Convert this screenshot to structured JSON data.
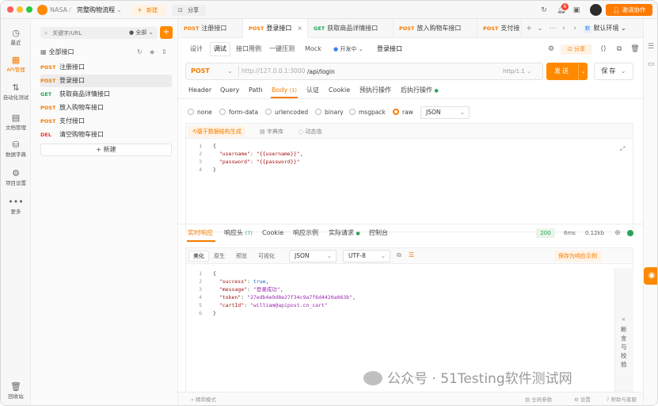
{
  "titlebar": {
    "team": "NASA",
    "project": "完整购物流程",
    "new_label": "新建",
    "share_label": "分享",
    "notif_count": "6",
    "invite_label": "邀请协作"
  },
  "leftnav": [
    {
      "label": "最近",
      "icon": "clock-icon",
      "glyph": "◷"
    },
    {
      "label": "API管理",
      "icon": "api-icon",
      "glyph": "▦"
    },
    {
      "label": "自动化测试",
      "icon": "flow-icon",
      "glyph": "⇅"
    },
    {
      "label": "文档管理",
      "icon": "doc-icon",
      "glyph": "▤"
    },
    {
      "label": "数据字典",
      "icon": "dict-icon",
      "glyph": "⛁"
    },
    {
      "label": "项目设置",
      "icon": "gear-icon",
      "glyph": "⚙"
    },
    {
      "label": "更多",
      "icon": "more-icon",
      "glyph": "•••"
    },
    {
      "label": "回收站",
      "icon": "trash-icon",
      "glyph": "🗑"
    }
  ],
  "tree": {
    "search_placeholder": "关键字/URL",
    "filter": "全部",
    "root": "全部接口",
    "items": [
      {
        "method": "POST",
        "name": "注册接口"
      },
      {
        "method": "POST",
        "name": "登录接口"
      },
      {
        "method": "GET",
        "name": "获取商品详情接口"
      },
      {
        "method": "POST",
        "name": "放入购物车接口"
      },
      {
        "method": "POST",
        "name": "支付接口"
      },
      {
        "method": "DEL",
        "name": "清空购物车接口"
      }
    ],
    "new_label": "新建"
  },
  "tabs": [
    {
      "method": "POST",
      "name": "注册接口"
    },
    {
      "method": "POST",
      "name": "登录接口"
    },
    {
      "method": "GET",
      "name": "获取商品详情接口"
    },
    {
      "method": "POST",
      "name": "放入购物车接口"
    },
    {
      "method": "POST",
      "name": "支付接"
    }
  ],
  "env": {
    "badge": "默",
    "label": "默认环境"
  },
  "subnav": {
    "items": [
      "设计",
      "调试",
      "接口用例",
      "一键压测",
      "Mock"
    ],
    "status": "开发中",
    "name": "登录接口",
    "share": "分享"
  },
  "request": {
    "method": "POST",
    "host": "http://127.0.0.1:3000",
    "path": "/api/login",
    "protocol": "http/1.1",
    "send": "发送",
    "save": "保存"
  },
  "req_tabs": {
    "items": [
      "Header",
      "Query",
      "Path",
      "Body",
      "认证",
      "Cookie",
      "预执行操作",
      "后执行操作"
    ],
    "body_count": "(1)"
  },
  "body_types": {
    "items": [
      "none",
      "form-data",
      "urlencoded",
      "binary",
      "msgpack",
      "raw"
    ],
    "format": "JSON"
  },
  "body_tools": [
    "基于数据结构生成",
    "字典库",
    "动态值"
  ],
  "body_code": [
    "{",
    "\"username\": \"{{username}}\",",
    "\"password\": \"{{password}}\"",
    "}"
  ],
  "resp_tabs": {
    "items": [
      "实时响应",
      "响应头",
      "Cookie",
      "响应示例",
      "实际请求",
      "控制台"
    ],
    "header_count": "(7)"
  },
  "resp_meta": {
    "status": "200",
    "time": "6ms",
    "size": "0.12kb"
  },
  "resp_view": {
    "items": [
      "美化",
      "原生",
      "预览",
      "可视化"
    ],
    "format": "JSON",
    "encoding": "UTF-8",
    "save_example": "保存为响应示例"
  },
  "resp_code": {
    "success": "true",
    "message": "\"登录成功\"",
    "token": "\"27edb4e9d8e27f34c9a7f6d4420a063b\"",
    "cartId": "\"william@apipost.cn_cart\""
  },
  "side_panel": "断言与校验",
  "footer": {
    "left": "精简模式",
    "items": [
      "全局参数",
      "设置",
      "帮助与客服"
    ]
  },
  "watermark": "公众号 · 51Testing软件测试网"
}
